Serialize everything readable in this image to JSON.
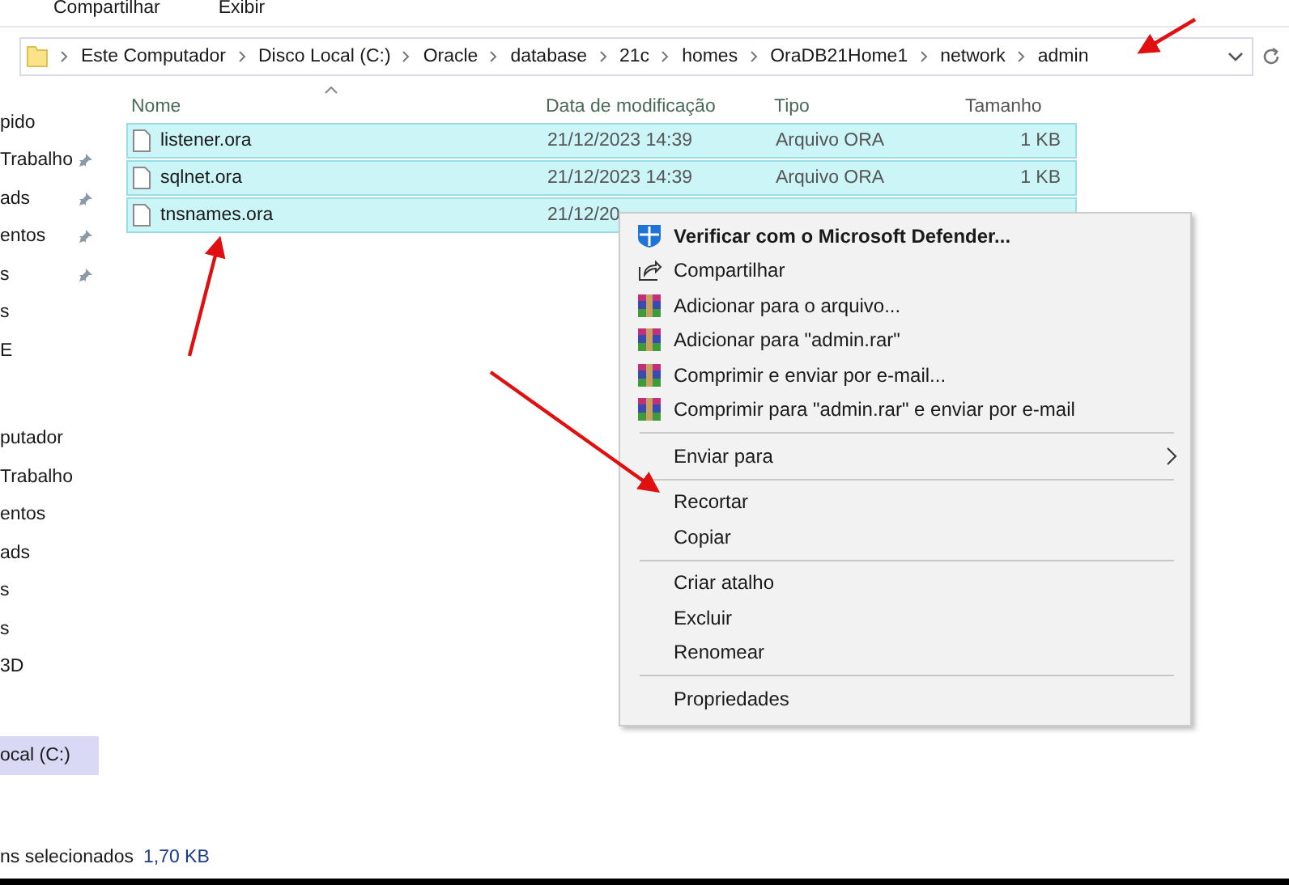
{
  "menu_bar": {
    "items": [
      "Compartilhar",
      "Exibir"
    ]
  },
  "address_bar": {
    "segments": [
      "Este Computador",
      "Disco Local (C:)",
      "Oracle",
      "database",
      "21c",
      "homes",
      "OraDB21Home1",
      "network",
      "admin"
    ]
  },
  "sidebar": {
    "groups": [
      {
        "items": [
          {
            "label": "pido",
            "pinned": false,
            "selected": false
          },
          {
            "label": "Trabalho",
            "pinned": true,
            "selected": false
          },
          {
            "label": "ads",
            "pinned": true,
            "selected": false
          },
          {
            "label": "entos",
            "pinned": true,
            "selected": false
          },
          {
            "label": "s",
            "pinned": true,
            "selected": false
          },
          {
            "label": "s",
            "pinned": false,
            "selected": false
          },
          {
            "label": "E",
            "pinned": false,
            "selected": false
          }
        ]
      },
      {
        "items": [
          {
            "label": "putador",
            "pinned": false,
            "selected": false
          },
          {
            "label": "Trabalho",
            "pinned": false,
            "selected": false
          },
          {
            "label": "entos",
            "pinned": false,
            "selected": false
          },
          {
            "label": "ads",
            "pinned": false,
            "selected": false
          },
          {
            "label": "s",
            "pinned": false,
            "selected": false
          },
          {
            "label": "s",
            "pinned": false,
            "selected": false
          },
          {
            "label": "3D",
            "pinned": false,
            "selected": false
          }
        ]
      },
      {
        "items": [
          {
            "label": "ocal (C:)",
            "pinned": false,
            "selected": true
          }
        ]
      }
    ]
  },
  "file_list": {
    "columns": [
      "Nome",
      "Data de modificação",
      "Tipo",
      "Tamanho"
    ],
    "rows": [
      {
        "name": "listener.ora",
        "date": "21/12/2023 14:39",
        "type": "Arquivo ORA",
        "size": "1 KB",
        "selected": true
      },
      {
        "name": "sqlnet.ora",
        "date": "21/12/2023 14:39",
        "type": "Arquivo ORA",
        "size": "1 KB",
        "selected": true
      },
      {
        "name": "tnsnames.ora",
        "date": "21/12/20",
        "selected": true
      }
    ]
  },
  "context_menu": {
    "groups": [
      [
        {
          "label": "Verificar com o Microsoft Defender...",
          "kind": "shield",
          "bold": true
        },
        {
          "label": "Compartilhar",
          "kind": "share",
          "bold": false
        },
        {
          "label": "Adicionar para o arquivo...",
          "kind": "archive",
          "bold": false
        },
        {
          "label": "Adicionar para \"admin.rar\"",
          "kind": "archive",
          "bold": false
        },
        {
          "label": "Comprimir e enviar por e-mail...",
          "kind": "archive",
          "bold": false
        },
        {
          "label": "Comprimir para \"admin.rar\" e enviar por e-mail",
          "kind": "archive",
          "bold": false
        }
      ],
      [
        {
          "label": "Enviar para",
          "submenu": true
        }
      ],
      [
        {
          "label": "Recortar"
        },
        {
          "label": "Copiar"
        }
      ],
      [
        {
          "label": "Criar atalho"
        },
        {
          "label": "Excluir"
        },
        {
          "label": "Renomear"
        }
      ],
      [
        {
          "label": "Propriedades"
        }
      ]
    ]
  },
  "status_bar": {
    "selection": "ns selecionados",
    "size": "1,70 KB"
  }
}
